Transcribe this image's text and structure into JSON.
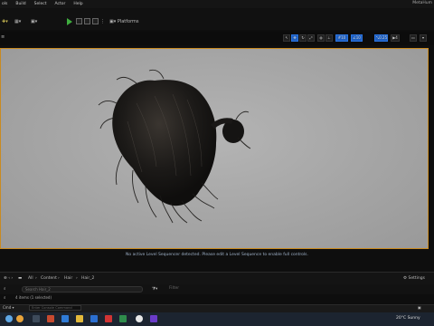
{
  "menu": {
    "items": [
      "ols",
      "Build",
      "Select",
      "Actor",
      "Help"
    ],
    "window_title": "MetaHum"
  },
  "toolbar": {
    "platforms_label": "Platforms"
  },
  "viewport_toolbar": {
    "fov_value": "10",
    "grid_value": "10",
    "snap_value": "0.25",
    "camera_speed": "4",
    "icons": [
      "select-mode-icon",
      "translate-icon",
      "rotate-icon",
      "scale-icon",
      "world-icon",
      "surface-snap-icon",
      "grid-icon",
      "angle-snap-icon",
      "scale-snap-icon",
      "camera-speed-icon",
      "layout-icon",
      "settings-icon"
    ]
  },
  "viewport": {
    "message": "No active Level Sequencer detected. Please edit a Level Sequence to enable full controls."
  },
  "content_browser": {
    "breadcrumbs": [
      "All",
      "Content",
      "Hair",
      "Hair_2"
    ],
    "settings_label": "Settings",
    "search_placeholder": "Search Hair_2",
    "item_count": "4 items (1 selected)",
    "filter_label": "Filter"
  },
  "cmd": {
    "dropdown_label": "Cmd",
    "placeholder": "Enter Console Command"
  },
  "taskbar": {
    "temperature": "20°C",
    "weather_text": "Sunny"
  },
  "colors": {
    "accent": "#1f5fbf",
    "selection_outline": "#c98a20",
    "play_green": "#3fae3f"
  }
}
